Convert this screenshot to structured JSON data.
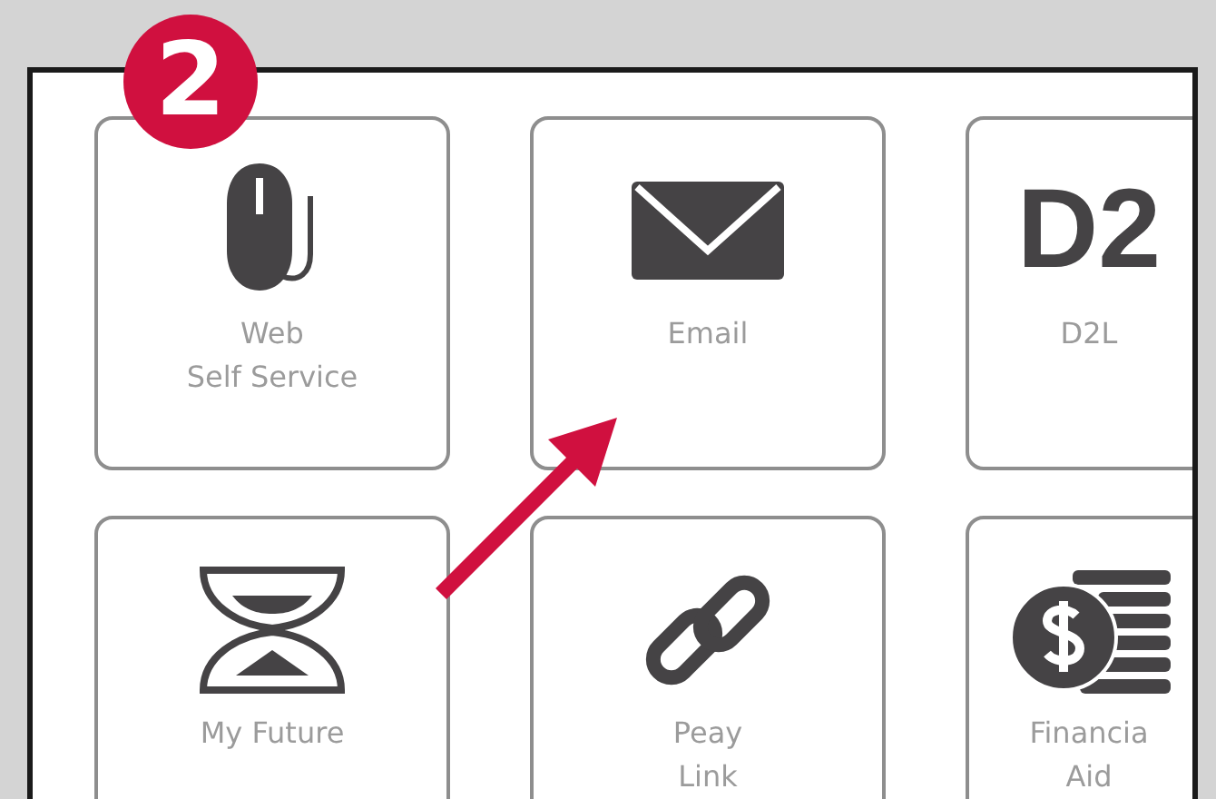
{
  "badge": "2",
  "tiles": [
    {
      "kind": "mouse",
      "label": "Web\nSelf Service"
    },
    {
      "kind": "envelope",
      "label": "Email"
    },
    {
      "kind": "text",
      "icon_text": "D2",
      "label": "D2L"
    },
    {
      "kind": "hourglass",
      "label": "My Future"
    },
    {
      "kind": "link",
      "label": "Peay\nLink"
    },
    {
      "kind": "coins",
      "label": "Financia\nAid"
    }
  ]
}
